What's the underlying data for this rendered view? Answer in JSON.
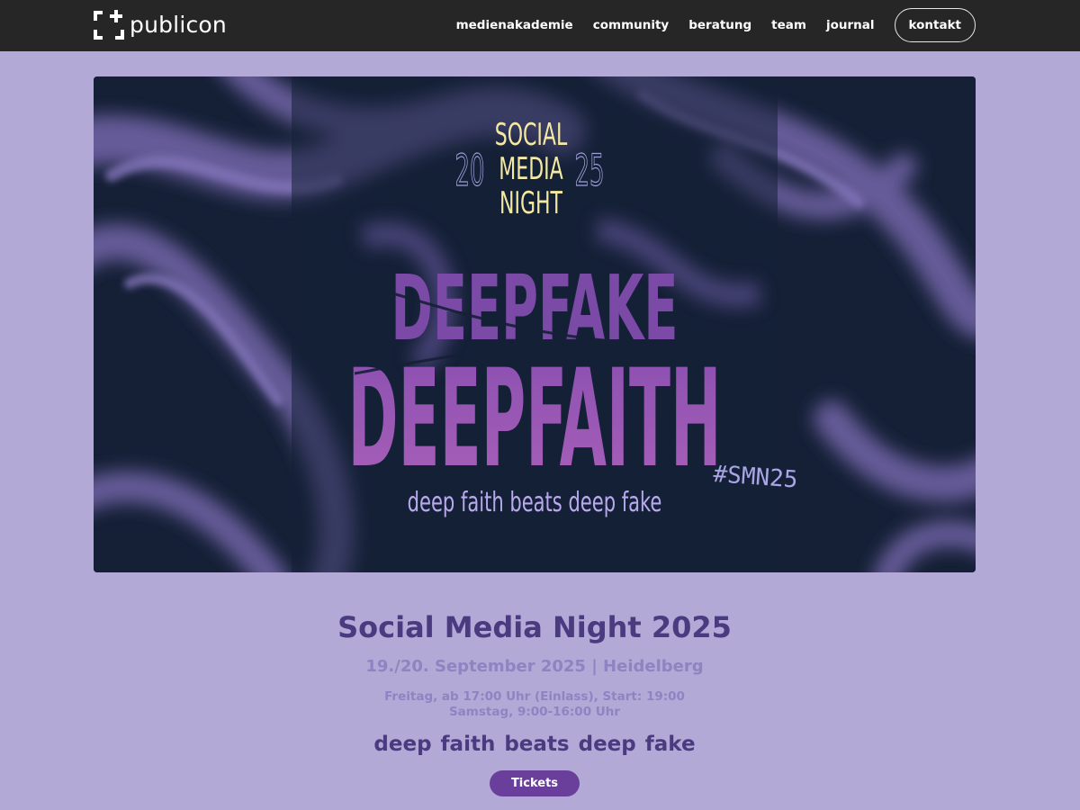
{
  "header": {
    "logo_text": "publicon",
    "nav": [
      "medienakademie",
      "community",
      "beratung",
      "team",
      "journal"
    ],
    "contact_label": "kontakt"
  },
  "hero": {
    "line1": "SOCIAL",
    "line2": "MEDIA",
    "line3": "NIGHT",
    "year_left": "20",
    "year_right": "25",
    "word1": "DEEPFAKE",
    "word2": "DEEPFAITH",
    "hashtag": "#SMN25",
    "tagline": "deep faith beats deep fake"
  },
  "event": {
    "title": "Social Media Night 2025",
    "date": "19./20. September 2025 | Heidelberg",
    "time_friday": "Freitag, ab 17:00 Uhr (Einlass), Start: 19:00",
    "time_saturday": "Samstag, 9:00-16:00 Uhr",
    "tagline": "deep faith beats deep fake",
    "tickets_label": "Tickets"
  },
  "colors": {
    "page_bg": "#b2a9d6",
    "nav_bg": "#262626",
    "title": "#4a3a80",
    "muted": "#8f83c2",
    "button": "#6a3f9c",
    "hero_bg": "#152036",
    "hero_yellow": "#f3e9a2",
    "hero_purple": "#9a5ab8"
  }
}
